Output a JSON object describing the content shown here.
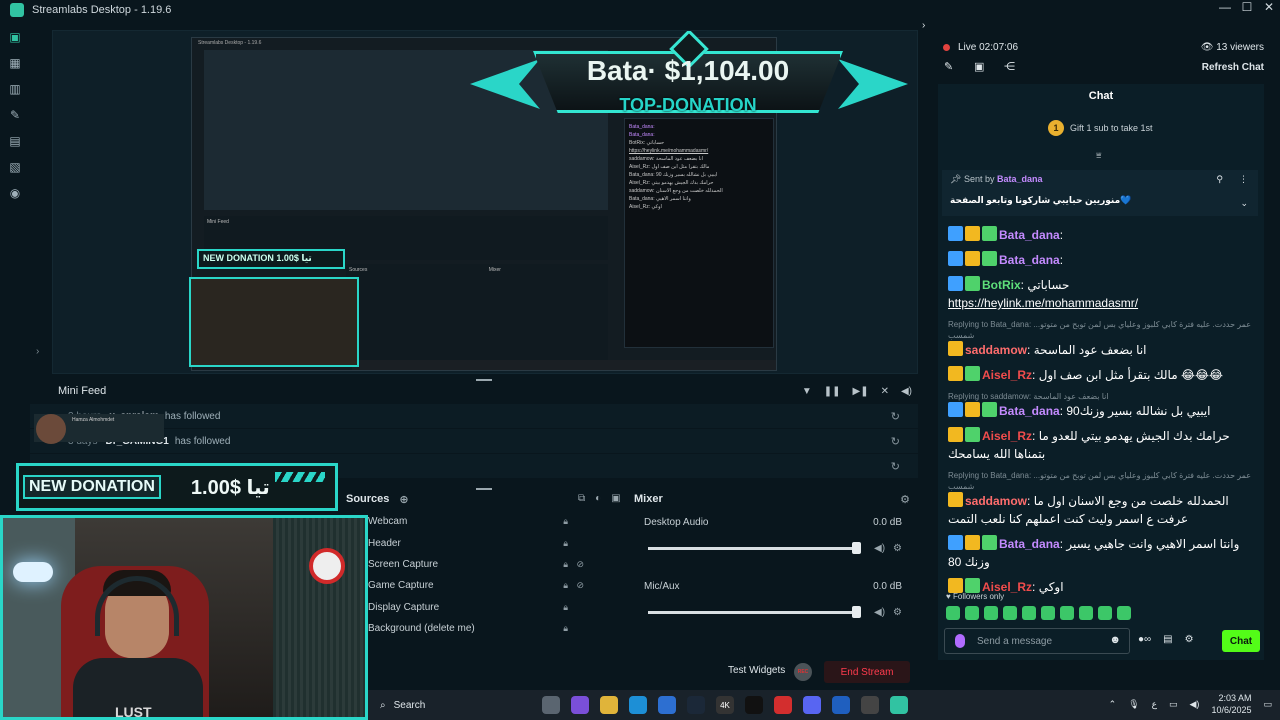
{
  "app": {
    "title": "Streamlabs Desktop - 1.19.6",
    "window_controls": [
      "—",
      "☐",
      "✕"
    ]
  },
  "nav": {
    "icons": [
      "editor-icon",
      "layouts-icon",
      "library-icon",
      "themes-icon",
      "store-icon",
      "apps-icon",
      "media-icon"
    ]
  },
  "preview": {
    "inner_title": "Streamlabs Desktop - 1.19.6",
    "inner_chat_lines": [
      "Bata_dana:",
      "Bata_dana:",
      "BotRix: حساباتي",
      "https://heylink.me/mohammadasmr/",
      "saddamow: انا بضعف عود الماسحة",
      "Aisel_Rz: مالك بتقرا مثل ابن صف اول",
      "Bata_dana: ايبيي بل نشالله بسير وزنك 90",
      "Aisel_Rz: حرامك بدك الجيش يهدمو بيتي",
      "saddamow: الحمدلله خلصت من وجع الاسنان",
      "Bata_dana: وانتا اسمر الاهيي",
      "Aisel_Rz: اوكي"
    ],
    "inner_feed": "Mini Feed",
    "inner_sources": "Sources",
    "inner_mixer": "Mixer",
    "inner_mini_donation": "NEW DONATION 1.00$ تيا"
  },
  "top_donation": {
    "amount_text": "Bata· $1,104.00",
    "label": "TOP-DONATION"
  },
  "mini_feed": {
    "title": "Mini Feed",
    "rows": [
      {
        "time": "3 hours",
        "user": "x_sprajam",
        "action": "has followed"
      },
      {
        "time": "3 days",
        "user": "Dr_GAMING1",
        "action": "has followed"
      },
      {
        "time": "",
        "user": "",
        "action": ""
      }
    ],
    "tooltip": "Hamza Almohmdet"
  },
  "donation_overlay": {
    "label": "NEW DONATION",
    "amount": "1.00$ تيا"
  },
  "webcam": {
    "shirt_text": "LUST"
  },
  "sources": {
    "title": "Sources",
    "items": [
      "Webcam",
      "Header",
      "Screen Capture",
      "Game Capture",
      "Display Capture",
      "Background (delete me)"
    ]
  },
  "mixer": {
    "title": "Mixer",
    "channels": [
      {
        "name": "Desktop Audio",
        "db": "0.0 dB",
        "level": 1.0
      },
      {
        "name": "Mic/Aux",
        "db": "0.0 dB",
        "level": 1.0
      }
    ]
  },
  "bottom": {
    "test_widgets": "Test Widgets",
    "rec": "REC",
    "end_stream": "End Stream"
  },
  "stream": {
    "live_label": "Live 02:07:06",
    "viewers": "13 viewers",
    "refresh_chat": "Refresh Chat"
  },
  "chat": {
    "title": "Chat",
    "gift_text": "Gift 1 sub to take 1st",
    "gift_count": "1",
    "pinned": {
      "sent_by": "Sent by",
      "user": "Bata_dana",
      "message": "منوريين حبايبي شاركونا وتابعو الصفحة💙"
    },
    "messages": [
      {
        "user": "Bata_dana",
        "text": "",
        "color": "purple"
      },
      {
        "user": "Bata_dana",
        "text": "",
        "color": "purple"
      },
      {
        "user": "BotRix",
        "text": "حساباتي",
        "link": "https://heylink.me/mohammadasmr/",
        "color": "green"
      },
      {
        "reply": "Replying to Bata_dana: ...عمر حددت. عليه فترة كابي كلبوز وعلياي بس لمن توبح من متوتو شمسب",
        "user": "saddamow",
        "text": "انا بضعف عود الماسحة",
        "color": "red"
      },
      {
        "user": "Aisel_Rz",
        "text": "مالك بتقرأ مثل ابن صف اول 😂😂😂",
        "color": "red2"
      },
      {
        "reply": "Replying to saddamow: انا بضعف عود الماسحة",
        "user": "Bata_dana",
        "text": "ايبيي بل نشالله بسير وزنك90",
        "color": "purple"
      },
      {
        "user": "Aisel_Rz",
        "text": "حرامك بدك الجيش يهدمو بيتي للعدو ما بتمناها الله يسامحك",
        "color": "red2"
      },
      {
        "reply": "Replying to Bata_dana: ...عمر حددت. عليه فترة كابي كلبوز وعلياي بس لمن توبح من متوتو شمسب",
        "user": "saddamow",
        "text": "الحمدلله خلصت من وجع الاسنان اول ما عرفت ع اسمر وليث كنت اعملهم كنا نلعب التمت",
        "color": "red"
      },
      {
        "user": "Bata_dana",
        "text": "وانتا اسمر الاهيي وانت جاهيي يسير وزنك 80",
        "color": "purple"
      },
      {
        "user": "Aisel_Rz",
        "text": "اوكي",
        "color": "red2"
      }
    ],
    "followers_only": "Followers only",
    "input_placeholder": "Send a message",
    "send_button": "Chat"
  },
  "taskbar": {
    "search": "Search",
    "time": "2:03 AM",
    "date": "10/6/2025",
    "lang": "ع"
  }
}
